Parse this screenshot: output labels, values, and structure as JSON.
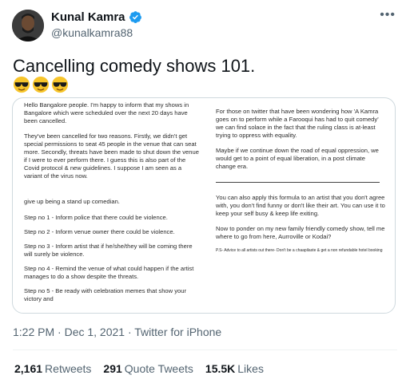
{
  "author": {
    "name": "Kunal Kamra",
    "handle": "@kunalkamra88"
  },
  "tweet": {
    "text": "Cancelling comedy shows 101.",
    "emoji": [
      "sunglasses-face",
      "sunglasses-face",
      "sunglasses-face"
    ]
  },
  "image_note": {
    "left": [
      "Hello Bangalore people. I'm happy to inform that my shows in Bangalore which were scheduled over the next 20 days have been cancelled.",
      "They've been cancelled for two reasons. Firstly, we didn't get special permissions to seat 45 people in the venue that can seat more. Secondly, threats have been made to shut down the venue if I were to ever perform there. I guess this is also part of the Covid protocol & new guidelines. I suppose I am seen as a variant of the virus now.",
      "give up being a stand up comedian."
    ],
    "steps": [
      "Step no 1 - Inform police that there could be violence.",
      "Step no 2 - Inform venue owner there could be violence.",
      "Step no 3 - Inform artist that if he/she/they will be coming there will surely be violence.",
      "Step no 4 - Remind the venue of what could happen if the artist manages to do a show despite the threats.",
      "Step no 5 - Be ready with celebration memes that show your victory and"
    ],
    "right": [
      "For those on twitter that have been wondering how 'A Kamra goes on to perform while a Farooqui has had to quit comedy' we can find solace in the fact that the ruling class is at-least trying to oppress with equality.",
      "Maybe if we continue down the road of equal oppression, we would get to a point of equal liberation, in a post climate change era.",
      "You can also apply this formula to an artist that you don't agree with, you don't find funny or don't like their art. You can use it to keep your self busy & keep life exiting.",
      "Now to ponder on my new family friendly comedy show, tell me where to go from here, Aurroville or Kodai?"
    ],
    "ps": "P.S- Advice to all artists out there- Don't be a chaapilaste & get a non refundable hotel booking"
  },
  "meta": {
    "time_date": "1:22 PM · Dec 1, 2021 · ",
    "source": "Twitter for iPhone"
  },
  "stats": {
    "retweets_count": "2,161",
    "retweets_label": "Retweets",
    "quotes_count": "291",
    "quotes_label": "Quote Tweets",
    "likes_count": "15.5K",
    "likes_label": "Likes"
  },
  "colors": {
    "verified": "#1d9bf0",
    "secondary_text": "#536471",
    "divider": "#eff3f4"
  }
}
